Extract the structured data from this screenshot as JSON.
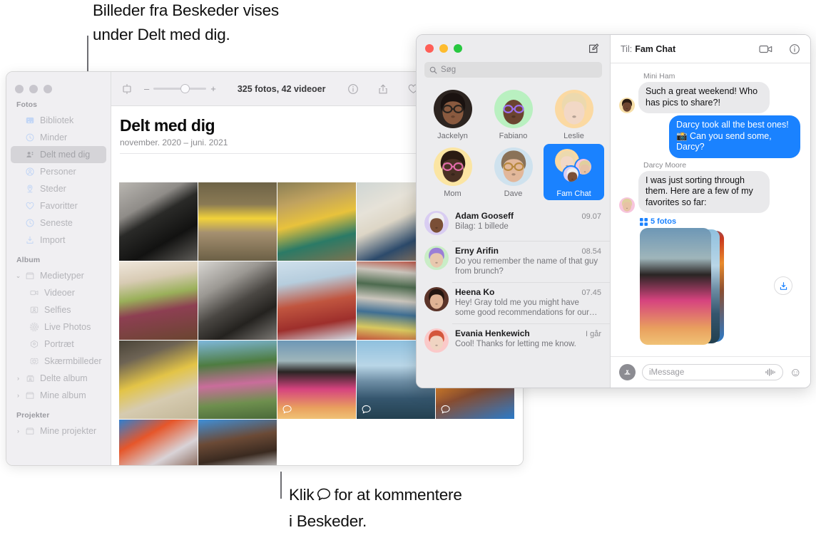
{
  "callouts": {
    "top": "Billeder fra Beskeder vises\nunder Delt med dig.",
    "bottom_before": "Klik",
    "bottom_after": "for at kommentere\ni Beskeder."
  },
  "photos_app": {
    "window_name": "Fotos",
    "toolbar": {
      "zoom_out_label": "–",
      "zoom_in_label": "+",
      "count_label": "325 fotos, 42 videoer",
      "icons": [
        "slideshow-icon",
        "info-icon",
        "share-icon",
        "favorite-icon",
        "search-icon"
      ]
    },
    "header": {
      "title": "Delt med dig",
      "subtitle": "november. 2020 – juni. 2021"
    },
    "sidebar": {
      "sections": [
        {
          "label": "Fotos",
          "items": [
            {
              "label": "Bibliotek",
              "icon": "library-icon",
              "selected": false,
              "indent": false,
              "disclosure": ""
            },
            {
              "label": "Minder",
              "icon": "memories-icon",
              "selected": false,
              "indent": false,
              "disclosure": ""
            },
            {
              "label": "Delt med dig",
              "icon": "shared-with-you-icon",
              "selected": true,
              "indent": false,
              "disclosure": ""
            },
            {
              "label": "Personer",
              "icon": "people-icon",
              "selected": false,
              "indent": false,
              "disclosure": ""
            },
            {
              "label": "Steder",
              "icon": "places-icon",
              "selected": false,
              "indent": false,
              "disclosure": ""
            },
            {
              "label": "Favoritter",
              "icon": "heart-icon",
              "selected": false,
              "indent": false,
              "disclosure": ""
            },
            {
              "label": "Seneste",
              "icon": "clock-icon",
              "selected": false,
              "indent": false,
              "disclosure": ""
            },
            {
              "label": "Import",
              "icon": "import-icon",
              "selected": false,
              "indent": false,
              "disclosure": ""
            }
          ]
        },
        {
          "label": "Album",
          "items": [
            {
              "label": "Medietyper",
              "icon": "folder-icon",
              "selected": false,
              "indent": false,
              "disclosure": "⌄"
            },
            {
              "label": "Videoer",
              "icon": "video-icon",
              "selected": false,
              "indent": true,
              "disclosure": ""
            },
            {
              "label": "Selfies",
              "icon": "selfie-icon",
              "selected": false,
              "indent": true,
              "disclosure": ""
            },
            {
              "label": "Live Photos",
              "icon": "live-photo-icon",
              "selected": false,
              "indent": true,
              "disclosure": ""
            },
            {
              "label": "Portræt",
              "icon": "portrait-icon",
              "selected": false,
              "indent": true,
              "disclosure": ""
            },
            {
              "label": "Skærmbilleder",
              "icon": "screenshot-icon",
              "selected": false,
              "indent": true,
              "disclosure": ""
            },
            {
              "label": "Delte album",
              "icon": "shared-album-icon",
              "selected": false,
              "indent": false,
              "disclosure": "›"
            },
            {
              "label": "Mine album",
              "icon": "folder-icon",
              "selected": false,
              "indent": false,
              "disclosure": "›"
            }
          ]
        },
        {
          "label": "Projekter",
          "items": [
            {
              "label": "Mine projekter",
              "icon": "folder-icon",
              "selected": false,
              "indent": false,
              "disclosure": "›"
            }
          ]
        }
      ]
    },
    "grid": {
      "comment_icon": "comment-bubble-icon",
      "photos": [
        {
          "name": "silhouette-bw",
          "commentable": false
        },
        {
          "name": "child-yellow-float",
          "commentable": false
        },
        {
          "name": "child-splashing-water",
          "commentable": false
        },
        {
          "name": "man-sitting-floor",
          "commentable": false
        },
        {
          "name": "pink-blue-pattern",
          "commentable": false
        },
        {
          "name": "fruit-bowl",
          "commentable": false
        },
        {
          "name": "woman-portrait-bw",
          "commentable": false
        },
        {
          "name": "woman-red-pants",
          "commentable": false
        },
        {
          "name": "colored-pipes",
          "commentable": false
        },
        {
          "name": "green-leaves",
          "commentable": false
        },
        {
          "name": "yellow-bowl",
          "commentable": false
        },
        {
          "name": "family-under-tree",
          "commentable": false
        },
        {
          "name": "woman-sunset-pink",
          "commentable": true
        },
        {
          "name": "beach-silhouettes",
          "commentable": true
        },
        {
          "name": "boy-popsicle",
          "commentable": true
        },
        {
          "name": "man-orange-umbrella",
          "commentable": true
        },
        {
          "name": "boy-and-man",
          "commentable": true
        }
      ]
    }
  },
  "messages_app": {
    "search_placeholder": "Søg",
    "compose_icon": "compose-icon",
    "pinned": [
      {
        "name": "Jackelyn",
        "avatar": "photo-avatar-jackelyn",
        "active": false
      },
      {
        "name": "Fabiano",
        "avatar": "memoji-fabiano",
        "active": false
      },
      {
        "name": "Leslie",
        "avatar": "memoji-leslie",
        "active": false
      },
      {
        "name": "Mom",
        "avatar": "memoji-mom",
        "active": false
      },
      {
        "name": "Dave",
        "avatar": "photo-avatar-dave",
        "active": false
      },
      {
        "name": "Fam Chat",
        "avatar": "group-avatar-fam-chat",
        "active": true
      }
    ],
    "conversations": [
      {
        "name": "Adam Gooseff",
        "time": "09.07",
        "preview": "Bilag:  1 billede",
        "avatar": "memoji-adam"
      },
      {
        "name": "Erny Arifin",
        "time": "08.54",
        "preview": "Do you remember the name of that guy from brunch?",
        "avatar": "memoji-erny"
      },
      {
        "name": "Heena Ko",
        "time": "07.45",
        "preview": "Hey! Gray told me you might have some good recommendations for our…",
        "avatar": "photo-avatar-heena"
      },
      {
        "name": "Evania Henkewich",
        "time": "I går",
        "preview": "Cool! Thanks for letting me know.",
        "avatar": "memoji-evania"
      }
    ],
    "thread": {
      "to_label": "Til:",
      "title": "Fam Chat",
      "facetime_icon": "video-camera-icon",
      "info_icon": "info-icon",
      "messages": [
        {
          "sender": "Mini Ham",
          "text": "Such a great weekend! Who has pics to share?!",
          "side": "them",
          "avatar": "memoji-mini-ham"
        },
        {
          "sender": "",
          "text": "Darcy took all the best ones! 📸 Can you send some, Darcy?",
          "side": "me",
          "avatar": ""
        },
        {
          "sender": "Darcy Moore",
          "text": "I was just sorting through them. Here are a few of my favorites so far:",
          "side": "them",
          "avatar": "memoji-darcy"
        }
      ],
      "attachment": {
        "count_label": "5 fotos",
        "grid_icon": "grid-icon",
        "save_icon": "save-download-icon"
      }
    },
    "composer": {
      "appstore_icon": "app-store-icon",
      "placeholder": "iMessage",
      "audio_icon": "audio-waveform-icon",
      "emoji_icon": "emoji-smiley-icon"
    }
  },
  "colors": {
    "accent_blue": "#1a82ff",
    "bubble_gray": "#e9e9eb",
    "sidebar_gray": "#f0eff2",
    "messages_sidebar": "#ececee"
  }
}
